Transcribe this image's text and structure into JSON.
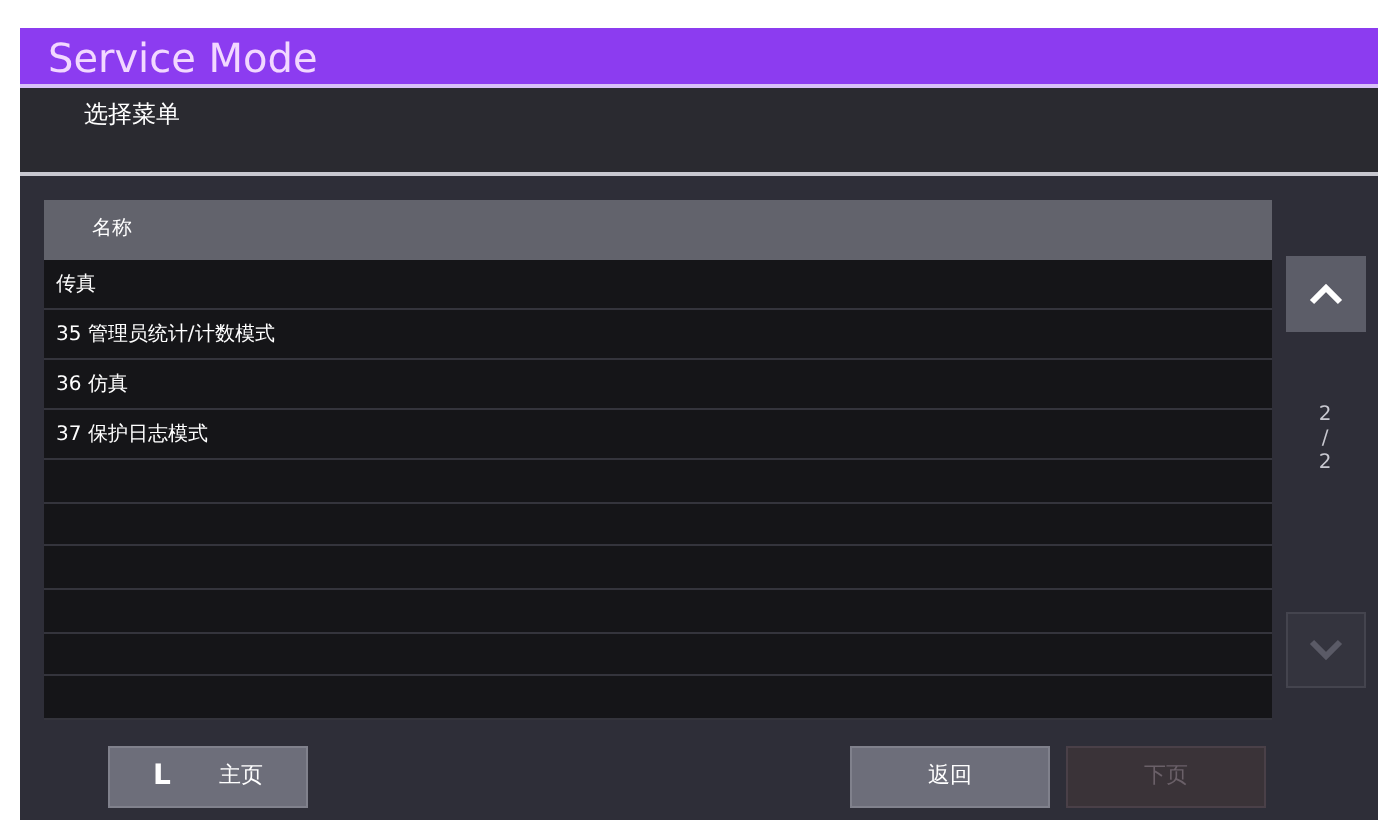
{
  "window": {
    "title": "Service Mode"
  },
  "subtitle": "选择菜单",
  "table": {
    "columns": [
      "名称"
    ],
    "rows": [
      {
        "name": "传真"
      },
      {
        "name": "35 管理员统计/计数模式"
      },
      {
        "name": "36 仿真"
      },
      {
        "name": "37 保护日志模式"
      }
    ]
  },
  "pager": {
    "current": "2",
    "separator": "/",
    "total": "2",
    "up": {
      "disabled": false
    },
    "down": {
      "disabled": true
    }
  },
  "left_buttons": [
    {
      "icon": "L",
      "label": "主页",
      "disabled": false
    }
  ],
  "right_buttons": [
    {
      "label": "返回",
      "disabled": false
    },
    {
      "label": "下页",
      "disabled": true
    }
  ]
}
